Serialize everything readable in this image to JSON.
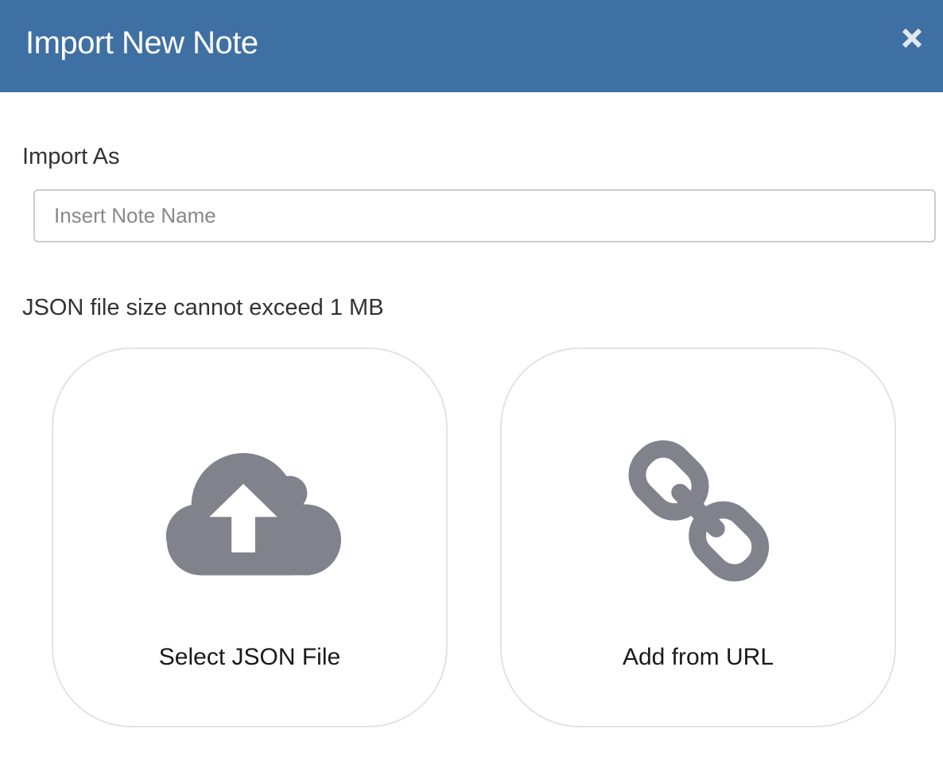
{
  "dialog": {
    "title": "Import New Note",
    "close_icon": "close-icon"
  },
  "form": {
    "import_as_label": "Import As",
    "note_name": {
      "value": "",
      "placeholder": "Insert Note Name"
    },
    "size_note": "JSON file size cannot exceed 1 MB"
  },
  "options": [
    {
      "label": "Select JSON File",
      "icon": "cloud-upload-icon"
    },
    {
      "label": "Add from URL",
      "icon": "link-icon"
    }
  ],
  "colors": {
    "header_bg": "#3f70a3",
    "icon_gray": "#80838c",
    "card_border": "#e3e3e3"
  }
}
